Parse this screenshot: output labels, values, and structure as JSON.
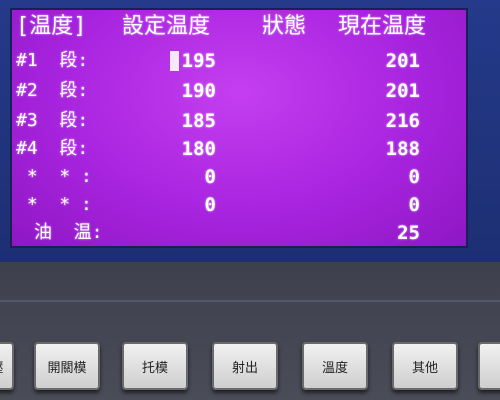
{
  "header": {
    "title_bracket": "[温度]",
    "col_set": "設定温度",
    "col_status": "狀態",
    "col_current": "現在温度"
  },
  "rows": [
    {
      "label": "#1  段:",
      "set": "195",
      "current": "201"
    },
    {
      "label": "#2  段:",
      "set": "190",
      "current": "201"
    },
    {
      "label": "#3  段:",
      "set": "185",
      "current": "216"
    },
    {
      "label": "#4  段:",
      "set": "180",
      "current": "188"
    },
    {
      "label": " *  * :",
      "set": "0",
      "current": "0"
    },
    {
      "label": " *  * :",
      "set": "0",
      "current": "0"
    }
  ],
  "oil": {
    "label": "油  温:",
    "current": "25"
  },
  "buttons": {
    "left_partial": "壓",
    "open_close": "開關模",
    "mold": "托模",
    "inject": "射出",
    "temp": "溫度",
    "other": "其他"
  },
  "colors": {
    "screen": "#b02be3",
    "bezel": "#1f3180",
    "text": "#ffffff"
  }
}
